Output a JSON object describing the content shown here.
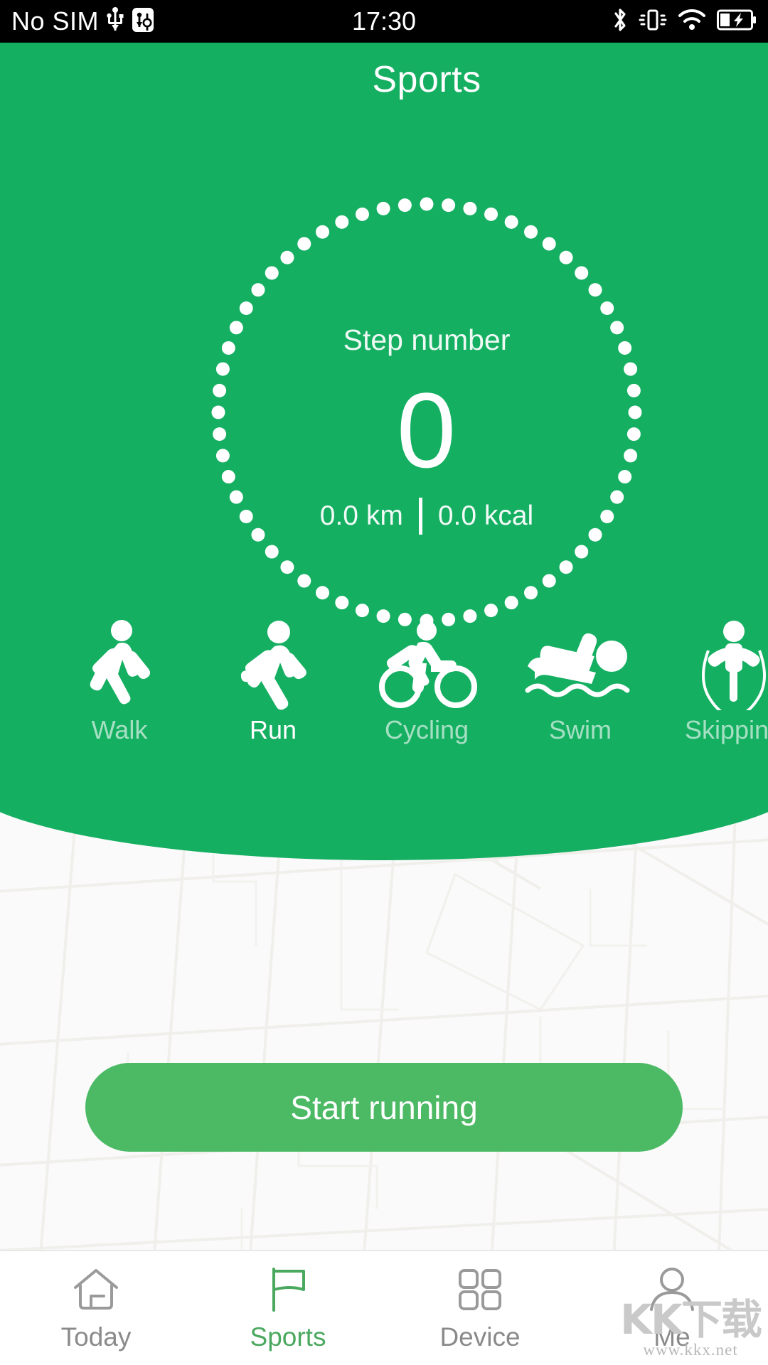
{
  "status_bar": {
    "carrier": "No SIM",
    "time": "17:30",
    "left_icons": [
      "usb-icon",
      "usb-debug-icon"
    ],
    "right_icons": [
      "bluetooth-icon",
      "vibrate-icon",
      "wifi-icon",
      "battery-charging-icon"
    ]
  },
  "header": {
    "title": "Sports",
    "background_color": "#15AF62"
  },
  "step_ring": {
    "label": "Step number",
    "value": "0",
    "distance": "0.0 km",
    "calories": "0.0 kcal",
    "dot_count": 60,
    "dot_color": "#FFFFFF"
  },
  "activities": [
    {
      "label": "Walk",
      "icon": "walk-icon",
      "active": false
    },
    {
      "label": "Run",
      "icon": "run-icon",
      "active": true
    },
    {
      "label": "Cycling",
      "icon": "cycling-icon",
      "active": false
    },
    {
      "label": "Swim",
      "icon": "swim-icon",
      "active": false
    },
    {
      "label": "Skipping",
      "icon": "skipping-icon",
      "active": false
    }
  ],
  "main": {
    "start_button_label": "Start running",
    "start_button_color": "#4CB964",
    "map_background_color": "#FAFAFA"
  },
  "tabbar": {
    "active_color": "#4AA85F",
    "inactive_color": "#8A8A8A",
    "items": [
      {
        "label": "Today",
        "icon": "home-icon",
        "active": false
      },
      {
        "label": "Sports",
        "icon": "flag-icon",
        "active": true
      },
      {
        "label": "Device",
        "icon": "grid-icon",
        "active": false
      },
      {
        "label": "Me",
        "icon": "person-icon",
        "active": false
      }
    ]
  },
  "watermark": {
    "main": "KK下载",
    "sub": "www.kkx.net"
  }
}
